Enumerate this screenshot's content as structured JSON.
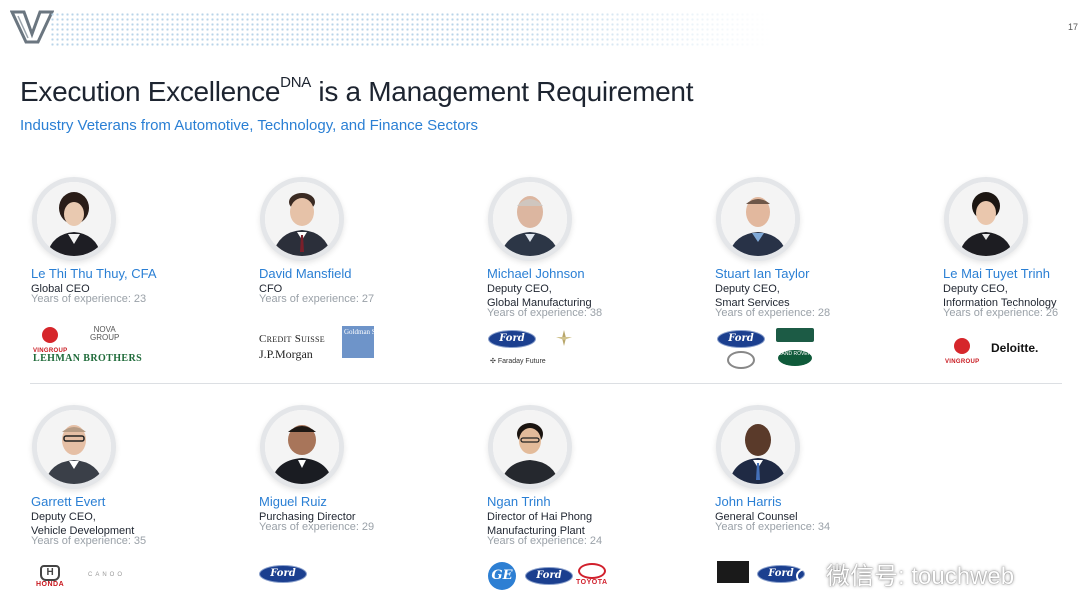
{
  "page": {
    "number": "17"
  },
  "title": {
    "main": "Execution Excellence",
    "sup": "DNA",
    "rest": " is a Management Requirement"
  },
  "subtitle": "Industry Veterans from Automotive, Technology, and Finance Sectors",
  "people": [
    {
      "name": "Le Thi Thu Thuy, CFA",
      "role": [
        "Global CEO"
      ],
      "years": "Years of experience: 23"
    },
    {
      "name": "David Mansfield",
      "role": [
        "CFO"
      ],
      "years": "Years of experience: 27"
    },
    {
      "name": "Michael Johnson",
      "role": [
        "Deputy CEO,",
        "Global Manufacturing"
      ],
      "years": "Years of experience: 38"
    },
    {
      "name": "Stuart Ian Taylor",
      "role": [
        "Deputy CEO,",
        "Smart Services"
      ],
      "years": "Years of experience: 28"
    },
    {
      "name": "Le Mai Tuyet Trinh",
      "role": [
        "Deputy CEO,",
        "Information Technology"
      ],
      "years": "Years of experience: 26"
    },
    {
      "name": "Garrett Evert",
      "role": [
        "Deputy CEO,",
        "Vehicle Development"
      ],
      "years": "Years of experience: 35"
    },
    {
      "name": "Miguel Ruiz",
      "role": [
        "Purchasing Director"
      ],
      "years": "Years of experience: 29"
    },
    {
      "name": "Ngan Trinh",
      "role": [
        "Director of Hai Phong",
        "Manufacturing Plant"
      ],
      "years": "Years of experience: 24"
    },
    {
      "name": "John Harris",
      "role": [
        "General Counsel"
      ],
      "years": "Years of experience: 34"
    }
  ],
  "brands": {
    "vingroup": "VINGROUP",
    "novagroup_top": "NOVA",
    "novagroup_bottom": "GROUP",
    "lehman": "LEHMAN BROTHERS",
    "credit_suisse": "Credit Suisse",
    "jpmorgan": "J.P.Morgan",
    "goldman": "Goldman Sachs",
    "ford": "Ford",
    "faraday": "Faraday Future",
    "land_rover": "LAND ROVER",
    "deloitte": "Deloitte.",
    "honda": "HONDA",
    "honda_h": "H",
    "cadence": "CANOO",
    "ge": "GE",
    "toyota": "TOYOTA"
  },
  "watermark": "微信号: touchweb",
  "colors": {
    "accent_blue": "#2a7fd4",
    "ford_blue": "#1b3f8f",
    "vingroup_red": "#c8161d"
  }
}
